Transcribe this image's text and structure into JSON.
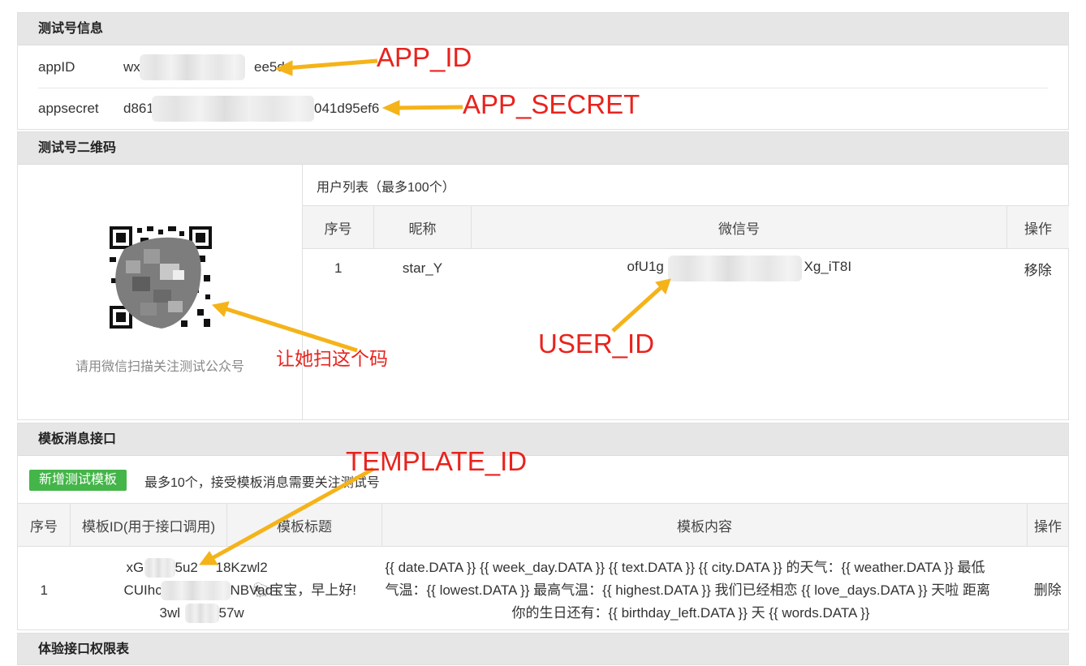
{
  "info": {
    "title": "测试号信息",
    "appid_label": "appID",
    "appid_prefix": "wx",
    "appid_suffix": "ee5d4",
    "secret_label": "appsecret",
    "secret_prefix": "d861",
    "secret_suffix": "041d95ef6"
  },
  "qr": {
    "title": "测试号二维码",
    "caption": "请用微信扫描关注测试公众号"
  },
  "users": {
    "title": "用户列表（最多100个）",
    "headers": [
      "序号",
      "昵称",
      "微信号",
      "操作"
    ],
    "rows": [
      {
        "index": "1",
        "nickname": "star_Y",
        "wechat_prefix": "ofU1g",
        "wechat_suffix": "Xg_iT8I",
        "action": "移除"
      }
    ]
  },
  "templates": {
    "title": "模板消息接口",
    "add_button": "新增测试模板",
    "tip": "最多10个，接受模板消息需要关注测试号",
    "headers": [
      "序号",
      "模板ID(用于接口调用)",
      "模板标题",
      "模板内容",
      "操作"
    ],
    "rows": [
      {
        "index": "1",
        "id_line1": "xG",
        "id_line1b": "5u2",
        "id_line1c": "18Kzwl2",
        "id_line2": "CUIhc",
        "id_line2b": "NBVad",
        "id_line3": "3wl",
        "id_line3b": "57w",
        "title": "🐑宝宝，早上好!",
        "content_line1": "{{ date.DATA }} {{ week_day.DATA }} {{ text.DATA }} {{ city.DATA }} 的天气：{{ weather.DATA }} 最低",
        "content_line2": "气温：{{ lowest.DATA }} 最高气温：{{ highest.DATA }} 我们已经相恋 {{ love_days.DATA }} 天啦 距离",
        "content_line3": "你的生日还有：{{ birthday_left.DATA }} 天 {{ words.DATA }}",
        "action": "删除"
      }
    ]
  },
  "next_panel": {
    "title": "体验接口权限表"
  },
  "annotations": {
    "app_id": "APP_ID",
    "app_secret": "APP_SECRET",
    "user_id": "USER_ID",
    "scan": "让她扫这个码",
    "template_id": "TEMPLATE_ID"
  },
  "colors": {
    "accent_green": "#44b549",
    "link_blue": "#4a90d9",
    "annotation_red": "#e8231d",
    "arrow_orange": "#f5b31a"
  }
}
